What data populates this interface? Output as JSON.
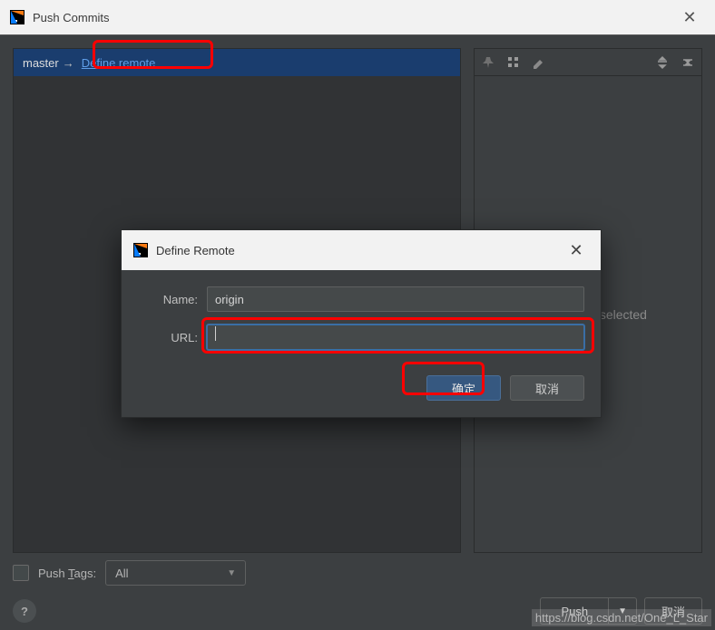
{
  "window": {
    "title": "Push Commits",
    "close_tooltip": "Close"
  },
  "branch": {
    "local": "master",
    "arrow": "→",
    "define_remote_link": "Define remote"
  },
  "right_panel": {
    "placeholder": "No commits selected"
  },
  "push_tags": {
    "checkbox_label_prefix": "Push ",
    "checkbox_label_underlined": "T",
    "checkbox_label_suffix": "ags:",
    "selected_option": "All"
  },
  "footer": {
    "push_label": "Push",
    "cancel_label": "取消"
  },
  "dialog": {
    "title": "Define Remote",
    "name_label": "Name:",
    "name_value": "origin",
    "url_label": "URL:",
    "url_value": "",
    "ok_label": "确定",
    "cancel_label": "取消"
  },
  "watermark": "https://blog.csdn.net/One_L_Star"
}
